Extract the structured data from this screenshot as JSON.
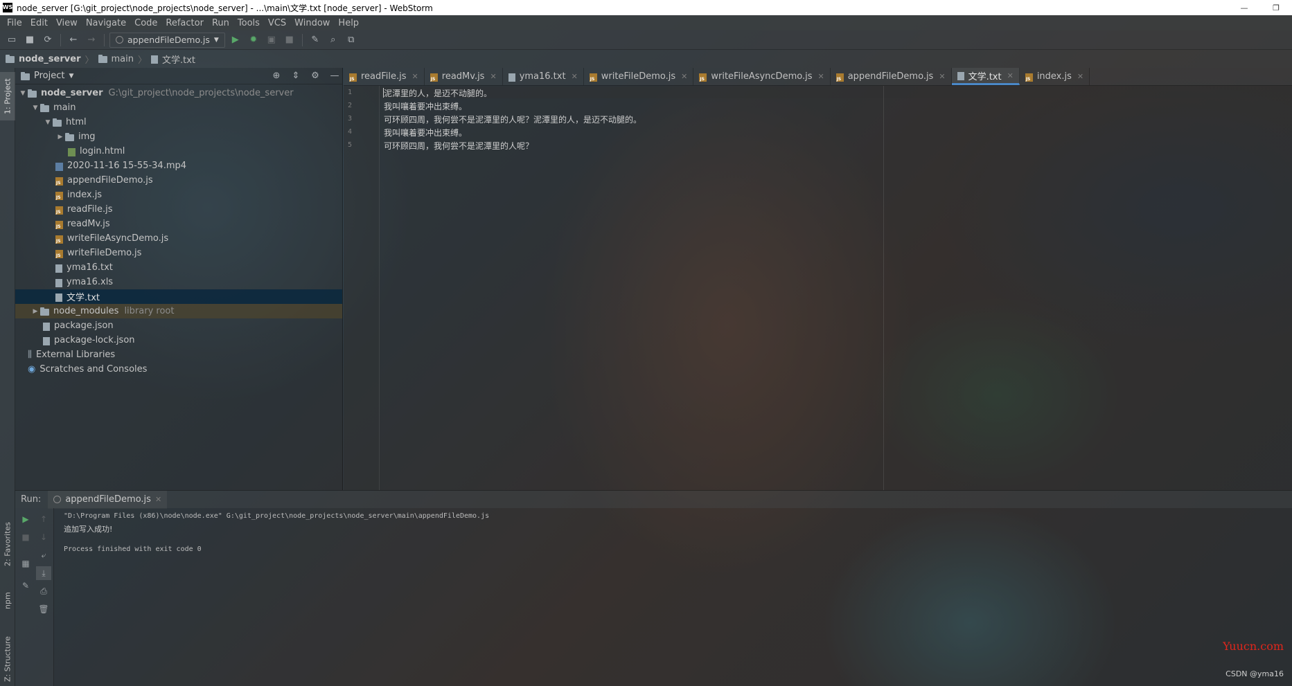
{
  "window": {
    "logo_text": "WS",
    "title": "node_server [G:\\git_project\\node_projects\\node_server] - ...\\main\\文学.txt [node_server] - WebStorm",
    "minimize": "—",
    "restore": "❐"
  },
  "menu": [
    "File",
    "Edit",
    "View",
    "Navigate",
    "Code",
    "Refactor",
    "Run",
    "Tools",
    "VCS",
    "Window",
    "Help"
  ],
  "toolbar": {
    "run_config": "appendFileDemo.js"
  },
  "breadcrumb": [
    "node_server",
    "main",
    "文学.txt"
  ],
  "left_stripe": {
    "project": "1: Project",
    "favorites": "2: Favorites",
    "npm": "npm",
    "structure": "Z: Structure"
  },
  "project_panel": {
    "title": "Project",
    "tree": [
      {
        "label": "node_server",
        "extra": "G:\\git_project\\node_projects\\node_server"
      },
      {
        "label": "main"
      },
      {
        "label": "html"
      },
      {
        "label": "img"
      },
      {
        "label": "login.html"
      },
      {
        "label": "2020-11-16 15-55-34.mp4"
      },
      {
        "label": "appendFileDemo.js"
      },
      {
        "label": "index.js"
      },
      {
        "label": "readFile.js"
      },
      {
        "label": "readMv.js"
      },
      {
        "label": "writeFileAsyncDemo.js"
      },
      {
        "label": "writeFileDemo.js"
      },
      {
        "label": "yma16.txt"
      },
      {
        "label": "yma16.xls"
      },
      {
        "label": "文学.txt"
      },
      {
        "label": "node_modules",
        "extra": "library root"
      },
      {
        "label": "package.json"
      },
      {
        "label": "package-lock.json"
      },
      {
        "label": "External Libraries"
      },
      {
        "label": "Scratches and Consoles"
      }
    ]
  },
  "editor_tabs": [
    {
      "label": "readFile.js"
    },
    {
      "label": "readMv.js"
    },
    {
      "label": "yma16.txt"
    },
    {
      "label": "writeFileDemo.js"
    },
    {
      "label": "writeFileAsyncDemo.js"
    },
    {
      "label": "appendFileDemo.js"
    },
    {
      "label": "文学.txt"
    },
    {
      "label": "index.js"
    }
  ],
  "editor": {
    "line_numbers": [
      "1",
      "2",
      "3",
      "4",
      "5"
    ],
    "lines": [
      "泥潭里的人，是迈不动腿的。",
      "我叫嚷着要冲出束缚。",
      "可环顾四周，我何尝不是泥潭里的人呢？泥潭里的人，是迈不动腿的。",
      "我叫嚷着要冲出束缚。",
      "可环顾四周，我何尝不是泥潭里的人呢？"
    ]
  },
  "run_panel": {
    "label": "Run:",
    "tab": "appendFileDemo.js",
    "console": [
      "\"D:\\Program Files (x86)\\node\\node.exe\" G:\\git_project\\node_projects\\node_server\\main\\appendFileDemo.js",
      "追加写入成功!",
      "Process finished with exit code 0"
    ]
  },
  "watermark": "Yuucn.com",
  "credit": "CSDN @yma16"
}
